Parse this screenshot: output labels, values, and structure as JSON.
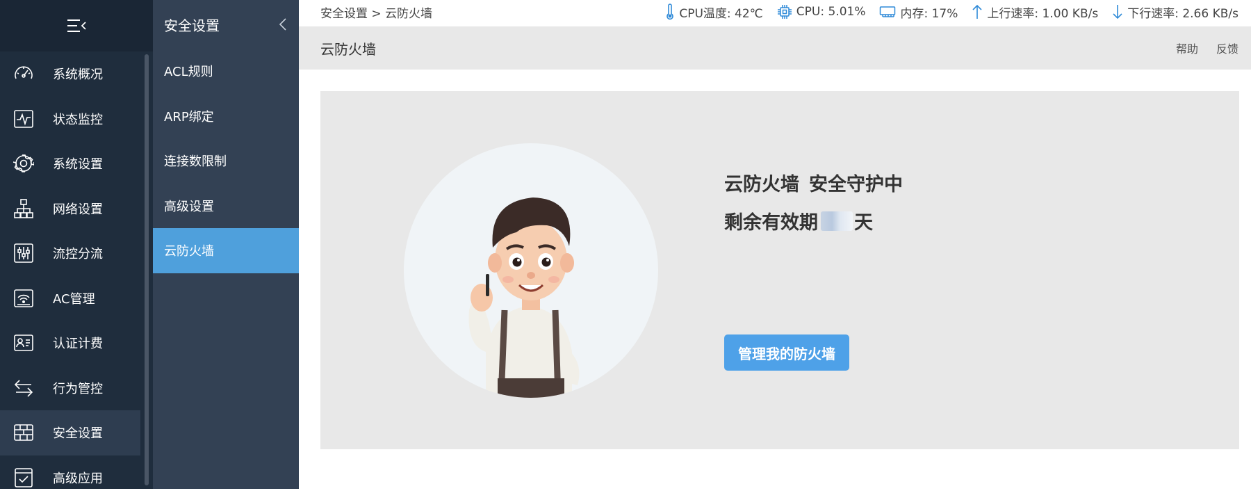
{
  "nav": {
    "items": [
      {
        "label": "系统概况",
        "icon": "dashboard-icon"
      },
      {
        "label": "状态监控",
        "icon": "monitor-icon"
      },
      {
        "label": "系统设置",
        "icon": "gear-icon"
      },
      {
        "label": "网络设置",
        "icon": "network-icon"
      },
      {
        "label": "流控分流",
        "icon": "sliders-icon"
      },
      {
        "label": "AC管理",
        "icon": "wifi-router-icon"
      },
      {
        "label": "认证计费",
        "icon": "id-card-icon"
      },
      {
        "label": "行为管控",
        "icon": "swap-arrows-icon"
      },
      {
        "label": "安全设置",
        "icon": "firewall-icon",
        "active": true
      },
      {
        "label": "高级应用",
        "icon": "checklist-icon"
      }
    ]
  },
  "subnav": {
    "title": "安全设置",
    "items": [
      {
        "label": "ACL规则"
      },
      {
        "label": "ARP绑定"
      },
      {
        "label": "连接数限制"
      },
      {
        "label": "高级设置"
      },
      {
        "label": "云防火墙",
        "active": true
      }
    ]
  },
  "topbar": {
    "breadcrumb": {
      "parent": "安全设置",
      "separator": ">",
      "current": "云防火墙"
    },
    "cpu_temp": "CPU温度: 42℃",
    "cpu_usage": "CPU: 5.01%",
    "memory": "内存: 17%",
    "upload": "上行速率: 1.00 KB/s",
    "download": "下行速率: 2.66 KB/s"
  },
  "page": {
    "title": "云防火墙",
    "help": "帮助",
    "feedback": "反馈"
  },
  "firewall": {
    "name": "云防火墙",
    "status": "安全守护中",
    "remaining_prefix": "剩余有效期",
    "remaining_suffix": "天",
    "manage_button": "管理我的防火墙"
  },
  "colors": {
    "nav_bg": "#1f2d3d",
    "subnav_bg": "#334154",
    "accent": "#4fa0dc",
    "button": "#4ea1e8",
    "icon_blue": "#2f8ad8"
  }
}
